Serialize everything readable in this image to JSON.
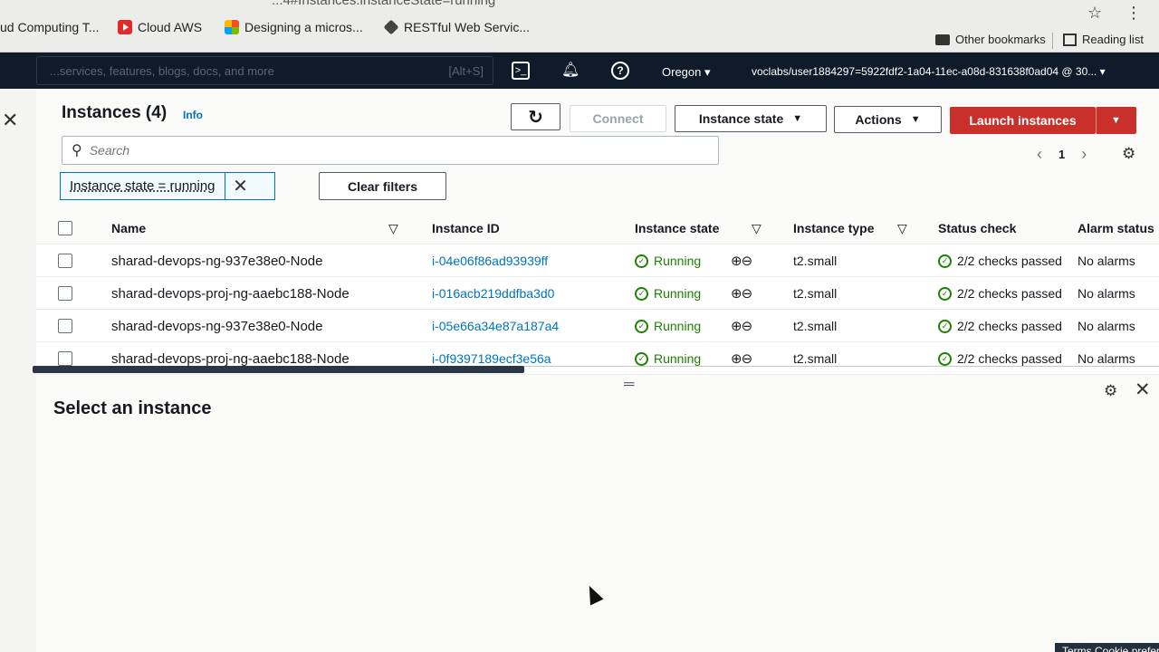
{
  "browser": {
    "url_fragment": "...4#Instances:instanceState=running",
    "bookmarks": [
      {
        "label": "ud Computing T...",
        "icon": "folder-icon"
      },
      {
        "label": "Cloud AWS",
        "icon": "youtube-icon"
      },
      {
        "label": "Designing a micros...",
        "icon": "microsoft-icon"
      },
      {
        "label": "RESTful Web Servic...",
        "icon": "web-icon"
      }
    ],
    "other_bookmarks": "Other bookmarks",
    "reading_list": "Reading list"
  },
  "aws_nav": {
    "search_placeholder": "...services, features, blogs, docs, and more",
    "search_shortcut": "[Alt+S]",
    "region": "Oregon",
    "account": "voclabs/user1884297=5922fdf2-1a04-11ec-a08d-831638f0ad04 @ 30..."
  },
  "header": {
    "title": "Instances (4)",
    "info": "Info",
    "connect": "Connect",
    "instance_state": "Instance state",
    "actions": "Actions",
    "launch": "Launch instances"
  },
  "search": {
    "placeholder": "Search"
  },
  "pagination": {
    "current_page": "1"
  },
  "filter": {
    "token": "Instance state = running",
    "clear": "Clear filters"
  },
  "table": {
    "columns": [
      "Name",
      "Instance ID",
      "Instance state",
      "Instance type",
      "Status check",
      "Alarm status"
    ],
    "rows": [
      {
        "name": "sharad-devops-ng-937e38e0-Node",
        "id": "i-04e06f86ad93939ff",
        "state": "Running",
        "type": "t2.small",
        "check": "2/2 checks passed",
        "alarm": "No alarms"
      },
      {
        "name": "sharad-devops-proj-ng-aaebc188-Node",
        "id": "i-016acb219ddfba3d0",
        "state": "Running",
        "type": "t2.small",
        "check": "2/2 checks passed",
        "alarm": "No alarms"
      },
      {
        "name": "sharad-devops-ng-937e38e0-Node",
        "id": "i-05e66a34e87a187a4",
        "state": "Running",
        "type": "t2.small",
        "check": "2/2 checks passed",
        "alarm": "No alarms"
      },
      {
        "name": "sharad-devops-proj-ng-aaebc188-Node",
        "id": "i-0f9397189ecf3e56a",
        "state": "Running",
        "type": "t2.small",
        "check": "2/2 checks passed",
        "alarm": "No alarms"
      }
    ]
  },
  "details": {
    "title": "Select an instance"
  },
  "footer": {
    "text": "Terms   Cookie preferenc..."
  },
  "colors": {
    "launch": "#c9302c",
    "running": "#1d8102",
    "link": "#0073bb",
    "nav_bg": "#0f1b2a"
  }
}
